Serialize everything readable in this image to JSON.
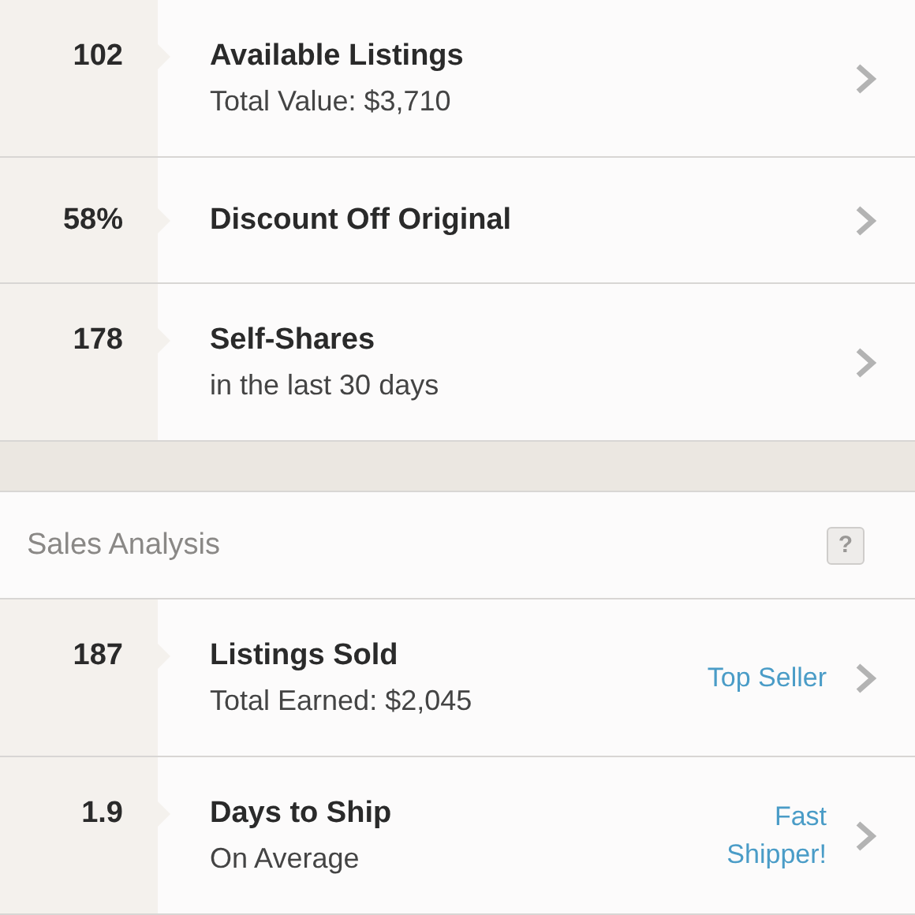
{
  "closet_stats": [
    {
      "value": "102",
      "title": "Available Listings",
      "subtitle": "Total Value: $3,710"
    },
    {
      "value": "58%",
      "title": "Discount Off Original"
    },
    {
      "value": "178",
      "title": "Self-Shares",
      "subtitle": "in the last 30 days"
    }
  ],
  "sales_analysis": {
    "title": "Sales Analysis",
    "help": "?",
    "rows": [
      {
        "value": "187",
        "title": "Listings Sold",
        "subtitle": "Total Earned: $2,045",
        "badge": "Top Seller"
      },
      {
        "value": "1.9",
        "title": "Days to Ship",
        "subtitle": "On Average",
        "badge": "Fast Shipper!"
      }
    ]
  }
}
